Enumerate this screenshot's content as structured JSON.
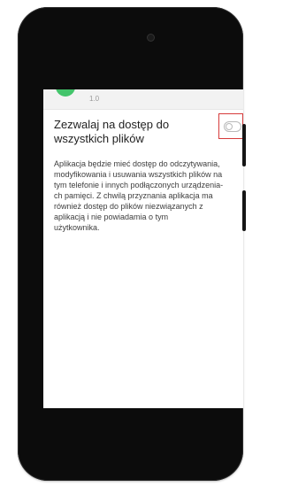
{
  "app": {
    "version": "1.0"
  },
  "setting": {
    "title": "Zezwalaj na dostęp do wszystkich plików",
    "enabled": false,
    "description_lines": [
      "Aplikacja będzie mieć dostęp do odczytywania,",
      "modyfikowania i usuwania wszystkich plików na",
      "tym telefonie i innych podłączonych urządzenia-",
      "ch pamięci. Z chwilą przyznania aplikacja ma",
      "również dostęp do plików niezwiązanych z",
      "aplikacją i nie powiadamia o tym",
      "użytkownika."
    ]
  },
  "colors": {
    "toggle_highlight": "#d63b3b",
    "app_icon": "#43c46b"
  }
}
